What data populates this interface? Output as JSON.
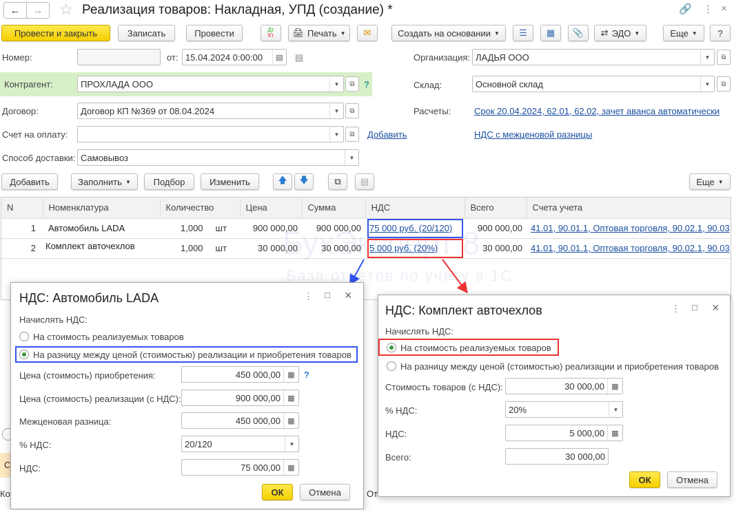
{
  "window": {
    "title": "Реализация товаров: Накладная, УПД (создание) *"
  },
  "toolbar": {
    "post_close": "Провести и закрыть",
    "save": "Записать",
    "post": "Провести",
    "dtkt_dt": "Дт",
    "dtkt_kt": "Кт",
    "print": "Печать",
    "create_based": "Создать на основании",
    "edo": "ЭДО",
    "more": "Еще",
    "help": "?"
  },
  "form": {
    "number_label": "Номер:",
    "number_value": "",
    "date_label": "от:",
    "date_value": "15.04.2024  0:00:00",
    "counterparty_label": "Контрагент:",
    "counterparty_value": "ПРОХЛАДА ООО",
    "help": "?",
    "contract_label": "Договор:",
    "contract_value": "Договор КП №369 от 08.04.2024",
    "invoice_label": "Счет на оплату:",
    "invoice_value": "",
    "add_link": "Добавить",
    "delivery_label": "Способ доставки:",
    "delivery_value": "Самовывоз",
    "org_label": "Организация:",
    "org_value": "ЛАДЬЯ ООО",
    "warehouse_label": "Склад:",
    "warehouse_value": "Основной склад",
    "settlements_label": "Расчеты:",
    "settlements_link": "Срок 20.04.2024, 62.01, 62.02, зачет аванса автоматически",
    "vat_link": "НДС с межценовой разницы"
  },
  "table_toolbar": {
    "add": "Добавить",
    "fill": "Заполнить",
    "selection": "Подбор",
    "change": "Изменить",
    "more": "Еще"
  },
  "table": {
    "columns": [
      "N",
      "Номенклатура",
      "Количество",
      "Цена",
      "Сумма",
      "НДС",
      "Всего",
      "Счета учета"
    ],
    "rows": [
      {
        "n": "1",
        "name": "Автомобиль LADA",
        "qty": "1,000",
        "unit": "шт",
        "price": "900 000,00",
        "sum": "900 000,00",
        "vat": "75 000 руб. (20/120)",
        "total": "900 000,00",
        "accounts": "41.01, 90.01.1, Оптовая торговля, 90.02.1, 90.03"
      },
      {
        "n": "2",
        "name": "Комплект авточехлов",
        "qty": "1,000",
        "unit": "шт",
        "price": "30 000,00",
        "sum": "30 000,00",
        "vat": "5 000 руб. (20%)",
        "total": "30 000,00",
        "accounts": "41.01, 90.01.1, Оптовая торговля, 90.02.1, 90.03"
      }
    ]
  },
  "watermark": {
    "brand": "БухЭксперт 8",
    "tagline": "База ответов по учету в 1С"
  },
  "background": {
    "frag1": "С",
    "frag2": "Ко",
    "frag3": "От"
  },
  "dialog1": {
    "title": "НДС: Автомобиль LADA",
    "accrue_label": "Начислять НДС:",
    "option1": "На стоимость реализуемых товаров",
    "option2": "На разницу между ценой (стоимостью) реализации и приобретения товаров",
    "purchase_label": "Цена (стоимость) приобретения:",
    "purchase_value": "450 000,00",
    "help": "?",
    "sale_label": "Цена (стоимость) реализации (с НДС):",
    "sale_value": "900 000,00",
    "diff_label": "Межценовая разница:",
    "diff_value": "450 000,00",
    "rate_label": "% НДС:",
    "rate_value": "20/120",
    "vat_label": "НДС:",
    "vat_value": "75 000,00",
    "ok": "ОК",
    "cancel": "Отмена"
  },
  "dialog2": {
    "title": "НДС: Комплект авточехлов",
    "accrue_label": "Начислять НДС:",
    "option1": "На стоимость реализуемых товаров",
    "option2": "На разницу между ценой (стоимостью) реализации и приобретения товаров",
    "cost_label": "Стоимость товаров (с НДС):",
    "cost_value": "30 000,00",
    "rate_label": "% НДС:",
    "rate_value": "20%",
    "vat_label": "НДС:",
    "vat_value": "5 000,00",
    "total_label": "Всего:",
    "total_value": "30 000,00",
    "ok": "ОК",
    "cancel": "Отмена"
  },
  "colors": {
    "accent_yellow": "#f5d000",
    "link": "#1a4fa0",
    "highlight_blue": "#3355ee",
    "highlight_red": "#ee3333",
    "counterparty_bg": "#d8f0c8"
  }
}
